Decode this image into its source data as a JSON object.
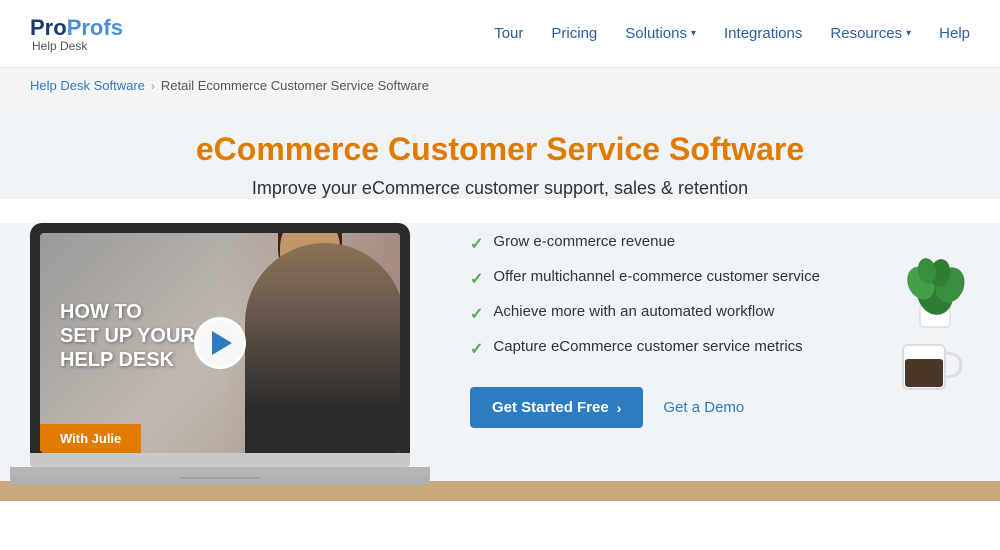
{
  "logo": {
    "pro": "Pro",
    "profs": "Profs",
    "sub": "Help Desk"
  },
  "nav": {
    "tour": "Tour",
    "pricing": "Pricing",
    "solutions": "Solutions",
    "integrations": "Integrations",
    "resources": "Resources",
    "help": "Help"
  },
  "breadcrumb": {
    "parent": "Help Desk Software",
    "separator": "›",
    "current": "Retail Ecommerce Customer Service Software"
  },
  "hero": {
    "title": "eCommerce Customer Service Software",
    "subtitle": "Improve your eCommerce customer support, sales & retention"
  },
  "video": {
    "line1": "HOW TO",
    "line2": "SET UP YOUR",
    "line3": "HELP DESK",
    "with_julie": "With Julie"
  },
  "features": [
    "Grow e-commerce revenue",
    "Offer multichannel e-commerce customer service",
    "Achieve more with an automated workflow",
    "Capture eCommerce customer service metrics"
  ],
  "cta": {
    "primary": "Get Started Free",
    "arrow": "›",
    "secondary": "Get a Demo"
  }
}
